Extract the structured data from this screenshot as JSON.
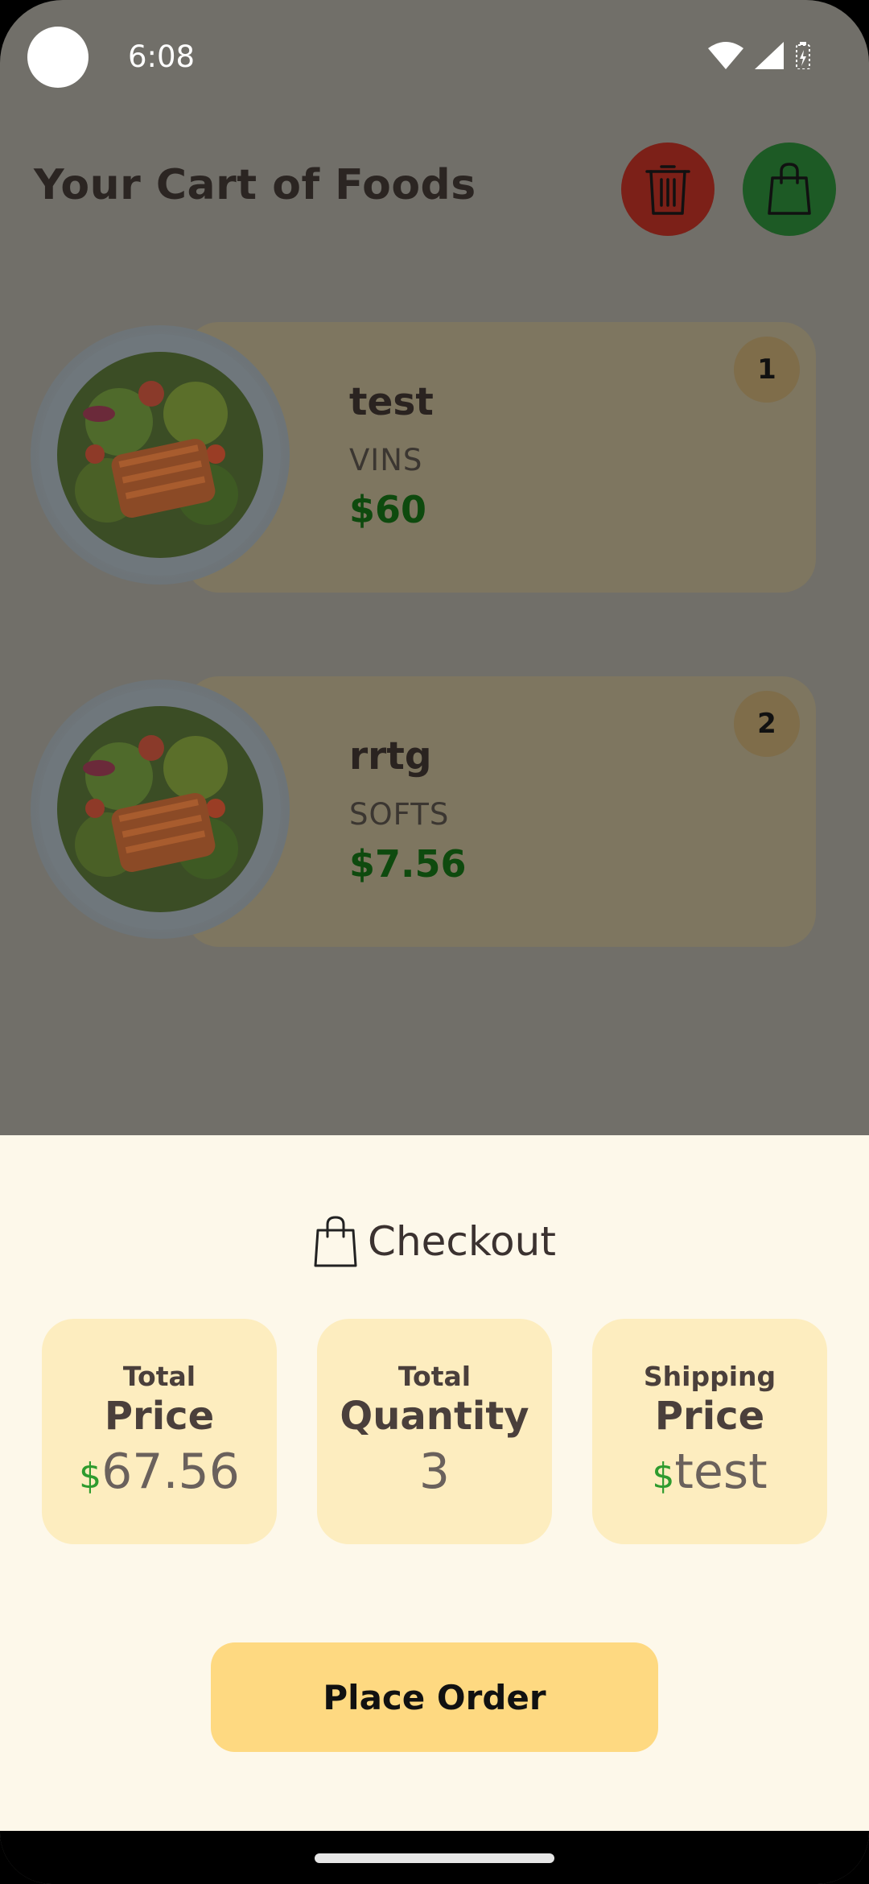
{
  "status_bar": {
    "time": "6:08",
    "icons": [
      "wifi-icon",
      "signal-icon",
      "battery-icon"
    ]
  },
  "header": {
    "title": "Your Cart of Foods",
    "delete_icon": "trash-icon",
    "bag_icon": "shopping-bag-icon"
  },
  "cart": {
    "items": [
      {
        "name": "test",
        "category": "VINS",
        "price": "$60",
        "quantity": "1"
      },
      {
        "name": "rrtg",
        "category": "SOFTS",
        "price": "$7.56",
        "quantity": "2"
      }
    ]
  },
  "checkout": {
    "title": "Checkout",
    "stats": [
      {
        "label_top": "Total",
        "label_main": "Price",
        "currency": "$",
        "value": "67.56"
      },
      {
        "label_top": "Total",
        "label_main": "Quantity",
        "currency": "",
        "value": "3"
      },
      {
        "label_top": "Shipping",
        "label_main": "Price",
        "currency": "$",
        "value": "test"
      }
    ],
    "place_order_label": "Place Order"
  },
  "colors": {
    "overlay_bg": "#716f69",
    "sheet_bg": "#fdf8ea",
    "stat_bg": "#fdedbf",
    "button_bg": "#fed981",
    "delete_btn": "#7c2018",
    "bag_btn": "#1d5a25",
    "price_green": "#0e4a0e",
    "currency_green": "#2e9b2e"
  }
}
